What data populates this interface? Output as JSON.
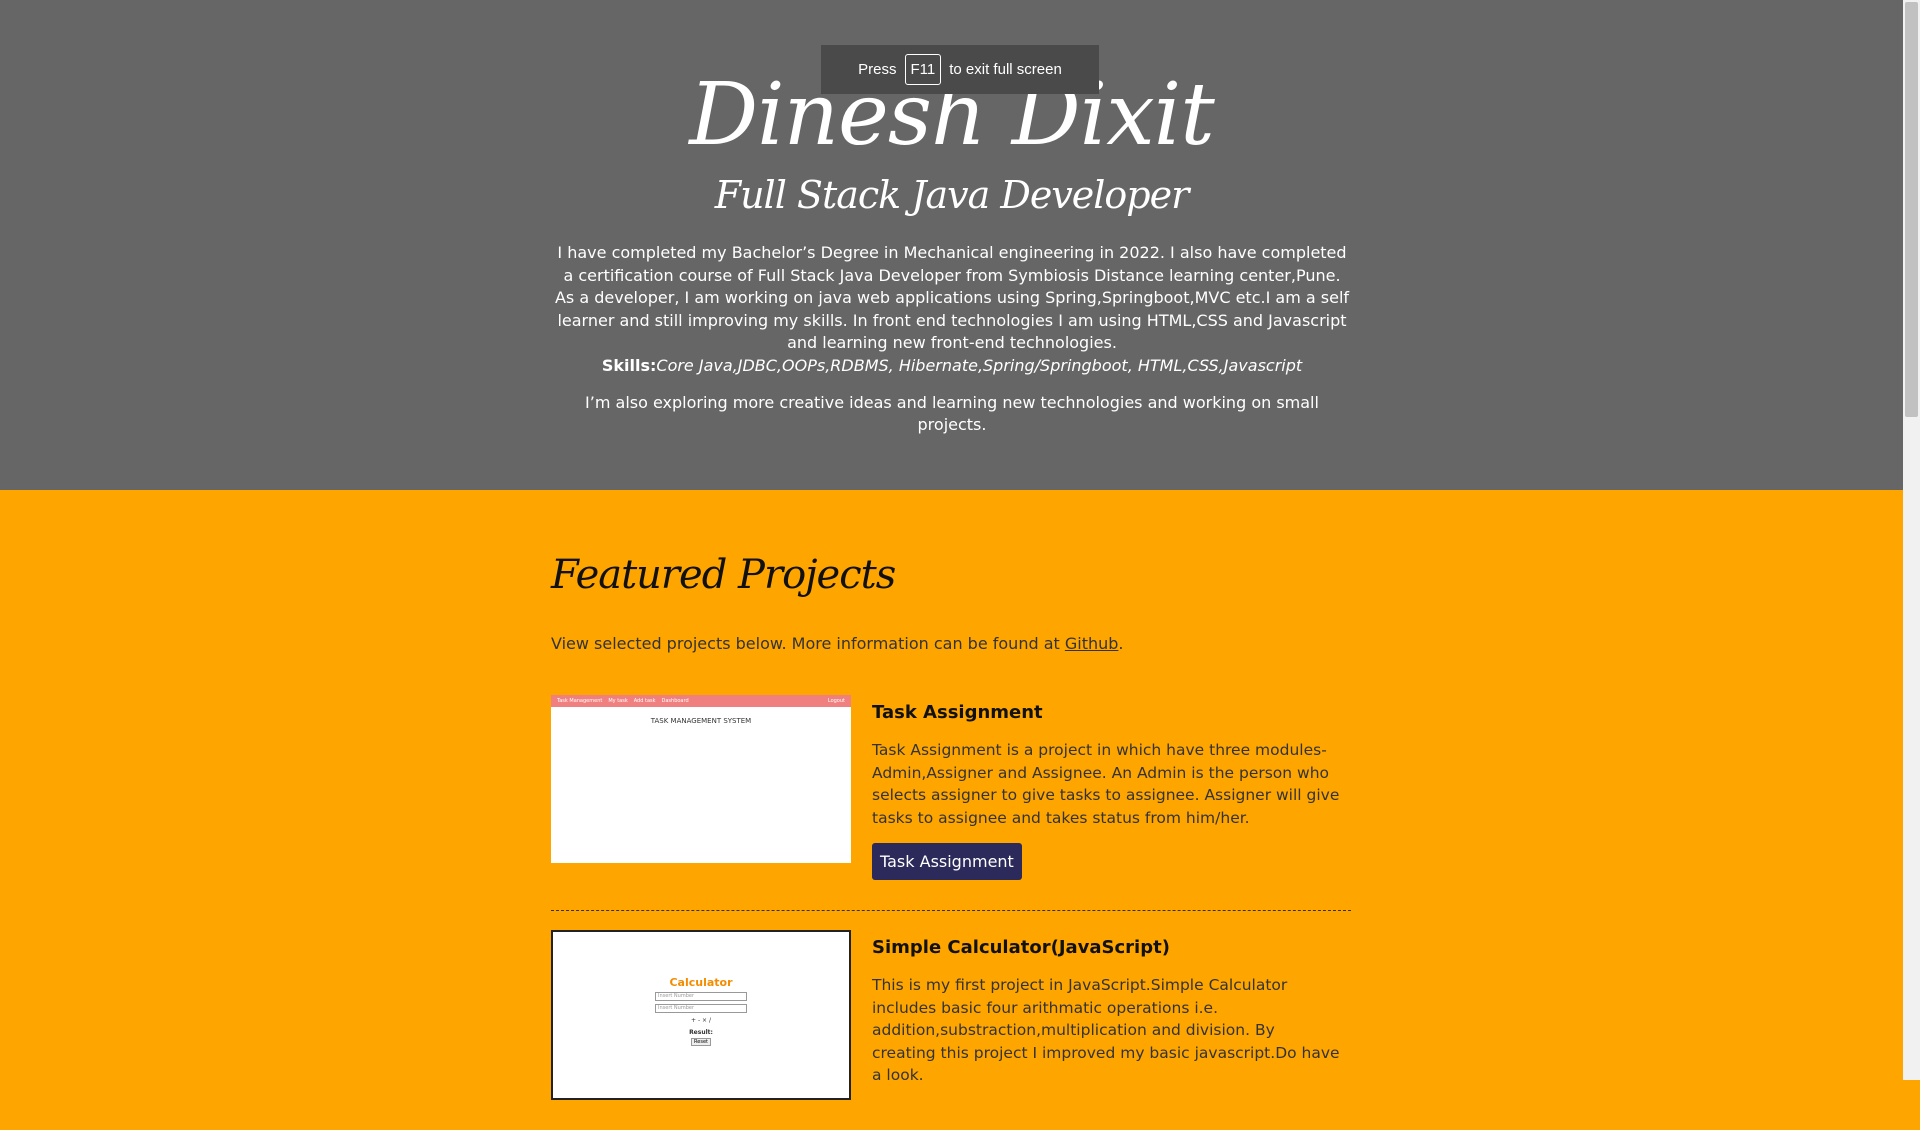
{
  "fullscreen_toast": {
    "press": "Press",
    "key": "F11",
    "message": "to exit full screen"
  },
  "hero": {
    "name": "Dinesh Dixit",
    "role": "Full Stack Java Developer",
    "bio": "I have completed my Bachelor’s Degree in Mechanical engineering in 2022. I also have completed a certification course of Full Stack Java Developer from Symbiosis Distance learning center,Pune. As a developer, I am working on java web applications using Spring,Springboot,MVC etc.I am a self learner and still improving my skills. In front end technologies I am using HTML,CSS and Javascript and learning new front-end technologies.",
    "skills_label": "Skills:",
    "skills_list": "Core Java,JDBC,OOPs,RDBMS, Hibernate,Spring/Springboot, HTML,CSS,Javascript",
    "extra": "I’m also exploring more creative ideas and learning new technologies and working on small projects."
  },
  "projects_section": {
    "title": "Featured Projects",
    "intro_prefix": "View selected projects below. More information can be found at ",
    "github_link": "Github",
    "intro_suffix": ".",
    "projects": [
      {
        "title": "Task Assignment",
        "description": "Task Assignment is a project in which have three modules-Admin,Assigner and Assignee. An Admin is the person who selects assigner to give tasks to assignee. Assigner will give tasks to assignee and takes status from him/her.",
        "button": "Task Assignment",
        "thumb": {
          "bar_brand": "Task Management",
          "bar_links": [
            "My task",
            "Add task",
            "Dashboard"
          ],
          "bar_right": "Logout",
          "heading": "TASK MANAGEMENT SYSTEM"
        }
      },
      {
        "title": "Simple Calculator(JavaScript)",
        "description": "This is my first project in JavaScript.Simple Calculator includes basic four arithmatic operations i.e. addition,substraction,multiplication and division. By creating this project I improved my basic javascript.Do have a look.",
        "thumb": {
          "heading": "Calculator",
          "field_1": "Insert Number",
          "field_2": "Insert Number",
          "ops": "+ - × /",
          "result": "Result:",
          "reset": "Reset"
        }
      }
    ]
  },
  "colors": {
    "hero_bg": "#666666",
    "page_bg": "#ffa500",
    "button_bg": "#2b2a5b"
  }
}
